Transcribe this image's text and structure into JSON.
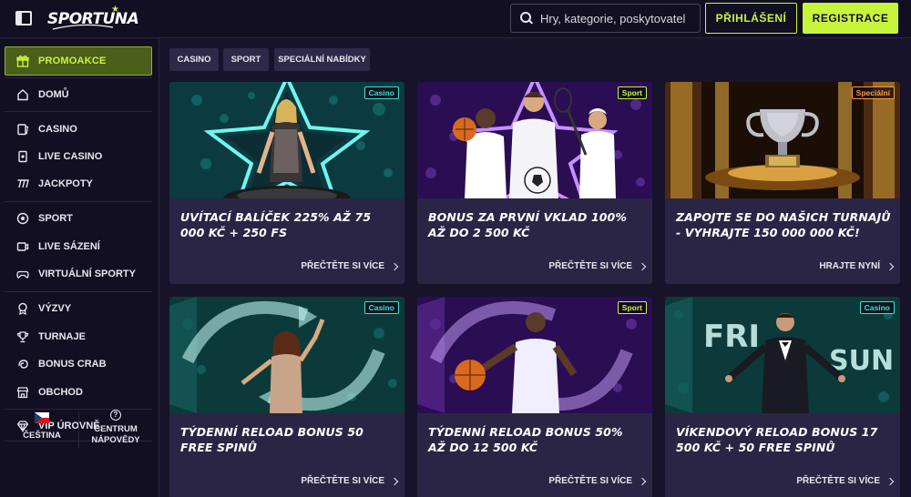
{
  "header": {
    "logo_text": "SPORTUNA",
    "search_placeholder": "Hry, kategorie, poskytovatelé",
    "login_label": "PŘIHLÁŠENÍ",
    "register_label": "REGISTRACE"
  },
  "sidebar": {
    "promo_label": "PROMOAKCE",
    "items": [
      {
        "label": "DOMŮ",
        "icon": "home-icon"
      },
      {
        "label": "CASINO",
        "icon": "cards-icon"
      },
      {
        "label": "LIVE CASINO",
        "icon": "live-card-icon"
      },
      {
        "label": "JACKPOTY",
        "icon": "jackpot-icon"
      },
      {
        "label": "SPORT",
        "icon": "soccer-ball-icon"
      },
      {
        "label": "LIVE SÁZENÍ",
        "icon": "live-tv-icon"
      },
      {
        "label": "VIRTUÁLNÍ SPORTY",
        "icon": "gamepad-icon"
      },
      {
        "label": "VÝZVY",
        "icon": "medal-icon"
      },
      {
        "label": "TURNAJE",
        "icon": "trophy-icon"
      },
      {
        "label": "BONUS CRAB",
        "icon": "crab-icon"
      },
      {
        "label": "OBCHOD",
        "icon": "shop-icon"
      },
      {
        "label": "VIP ÚROVNĚ",
        "icon": "diamond-icon"
      }
    ],
    "language_label": "ČEŠTINA",
    "help_label_line1": "CENTRUM",
    "help_label_line2": "NÁPOVĚDY"
  },
  "tabs": [
    "CASINO",
    "SPORT",
    "SPECIÁLNÍ NABÍDKY"
  ],
  "cards": [
    {
      "badge": "Casino",
      "title": "UVÍTACÍ BALÍČEK 225% AŽ 75 000 KČ + 250 FS",
      "link": "PŘEČTĚTE SI VÍCE"
    },
    {
      "badge": "Sport",
      "title": "BONUS ZA PRVNÍ VKLAD 100% AŽ DO 2 500 KČ",
      "link": "PŘEČTĚTE SI VÍCE"
    },
    {
      "badge": "Speciální",
      "title": "ZAPOJTE SE DO NAŠICH TURNAJŮ - VYHRAJTE 150 000 000 KČ!",
      "link": "HRAJTE NYNÍ"
    },
    {
      "badge": "Casino",
      "title": "TÝDENNÍ RELOAD BONUS 50 FREE SPINŮ",
      "link": "PŘEČTĚTE SI VÍCE"
    },
    {
      "badge": "Sport",
      "title": "TÝDENNÍ RELOAD BONUS 50% AŽ DO 12 500 KČ",
      "link": "PŘEČTĚTE SI VÍCE"
    },
    {
      "badge": "Casino",
      "title": "VÍKENDOVÝ RELOAD BONUS 17 500 KČ + 50 FREE SPINŮ",
      "link": "PŘEČTĚTE SI VÍCE"
    }
  ],
  "card6_art": {
    "left_text": "FRI",
    "right_text": "SUN"
  },
  "colors": {
    "accent": "#c8f53c",
    "casino": "#36e2d8",
    "sport": "#c8f53c",
    "special": "#ff9b3d",
    "bg": "#17132a",
    "card": "#2b2545"
  }
}
